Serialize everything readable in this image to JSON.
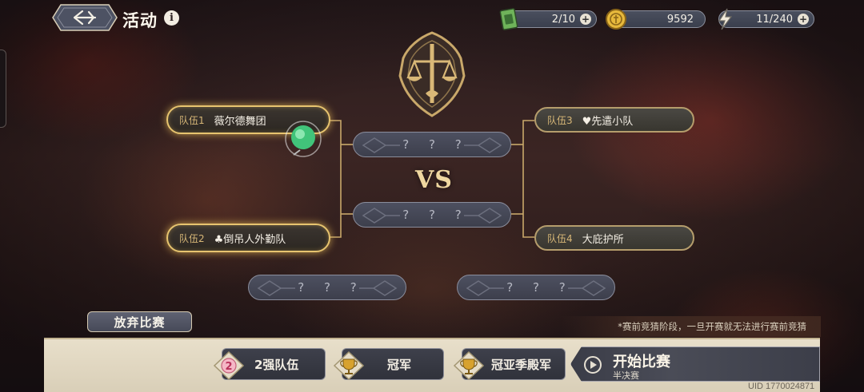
{
  "header": {
    "title": "活动",
    "info_glyph": "i"
  },
  "resources": [
    {
      "icon": "ticket-icon",
      "value": "2/10"
    },
    {
      "icon": "gold-coin-icon",
      "value": "9592"
    },
    {
      "icon": "stamina-bolt-icon",
      "value": "11/240"
    }
  ],
  "bracket": {
    "teams": [
      {
        "label": "队伍1",
        "name": "薇尔德舞团",
        "selected": true
      },
      {
        "label": "队伍2",
        "name": "♣倒吊人外勤队",
        "selected": true
      },
      {
        "label": "队伍3",
        "name": "♥先遣小队",
        "selected": false
      },
      {
        "label": "队伍4",
        "name": "大庇护所",
        "selected": false
      }
    ],
    "slots": [
      "? ? ?",
      "? ? ?",
      "? ? ?",
      "? ? ?"
    ],
    "vs": "VS"
  },
  "bottom": {
    "abandon_label": "放弃比赛",
    "notice": "*赛前竞猜阶段，一旦开赛就无法进行赛前竞猜",
    "tabs": [
      {
        "badge": "2",
        "label": "2强队伍",
        "icon": "number-badge-icon"
      },
      {
        "label": "冠军",
        "icon": "trophy-icon"
      },
      {
        "label": "冠亚季殿军",
        "icon": "trophy-icon"
      }
    ],
    "start": {
      "title": "开始比赛",
      "subtitle": "半决赛"
    },
    "uid": "UID 1770024871"
  },
  "colors": {
    "gold_accent": "#e7c46f",
    "panel_bg": "#e2d8c3",
    "slot_bg": "#45485a"
  }
}
